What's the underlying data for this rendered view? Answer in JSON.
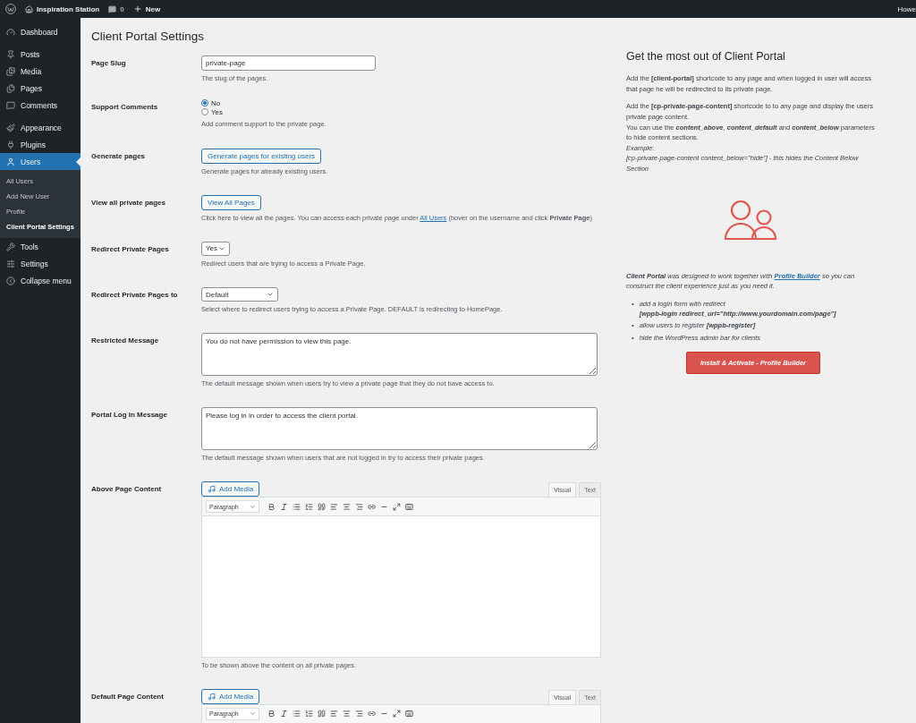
{
  "admin_bar": {
    "site_name": "Inspiration Station",
    "comments_count": "0",
    "new_label": "New",
    "greeting": "Howe"
  },
  "sidebar": {
    "items": [
      {
        "label": "Dashboard",
        "selected": false
      },
      {
        "label": "Posts",
        "selected": false
      },
      {
        "label": "Media",
        "selected": false
      },
      {
        "label": "Pages",
        "selected": false
      },
      {
        "label": "Comments",
        "selected": false
      },
      {
        "label": "Appearance",
        "selected": false
      },
      {
        "label": "Plugins",
        "selected": false
      },
      {
        "label": "Users",
        "selected": true,
        "children": [
          {
            "label": "All Users",
            "selected": false
          },
          {
            "label": "Add New User",
            "selected": false
          },
          {
            "label": "Profile",
            "selected": false
          },
          {
            "label": "Client Portal Settings",
            "selected": true
          }
        ]
      },
      {
        "label": "Tools",
        "selected": false
      },
      {
        "label": "Settings",
        "selected": false
      },
      {
        "label": "Collapse menu",
        "selected": false
      }
    ]
  },
  "page_title": "Client Portal Settings",
  "settings": [
    {
      "kind": "text",
      "label": "Page Slug",
      "value": "private-page",
      "description": "The slug of the pages."
    },
    {
      "kind": "radio",
      "label": "Support Comments",
      "options": [
        {
          "label": "No",
          "selected": true
        },
        {
          "label": "Yes",
          "selected": false
        }
      ],
      "description": "Add comment support to the private page."
    },
    {
      "kind": "button",
      "label": "Generate pages",
      "button": "Generate pages for existing users",
      "description": "Generate pages for already existing users."
    },
    {
      "kind": "button",
      "label": "View all private pages",
      "button": "View All Pages",
      "description": "Click here to view all the pages. You can access each private page under",
      "link": "All Users",
      "description_after": "(hover on the username and click **Private Page**)"
    },
    {
      "kind": "select",
      "label": "Redirect Private Pages",
      "value": "Yes",
      "description": "Redirect users that are trying to access a Private Page."
    },
    {
      "kind": "select",
      "label": "Redirect Private Pages to",
      "value": "Default",
      "description": "Select where to redirect users trying to access a Private Page. DEFAULT is redirecting to HomePage."
    },
    {
      "kind": "textarea",
      "label": "Restricted Message",
      "value": "You do not have permission to view this page.",
      "description": "The default message shown when users try to view a private page that they do not have access to."
    },
    {
      "kind": "textarea",
      "label": "Portal Log In Message",
      "value": "Please log in in order to access the client portal.",
      "description": "The default message shown when users that are not logged in try to access their private pages."
    },
    {
      "kind": "editor",
      "label": "Above Page Content",
      "add_media": "Add Media",
      "tabs": [
        {
          "label": "Visual",
          "selected": true
        },
        {
          "label": "Text",
          "selected": false
        }
      ],
      "format": "Paragraph",
      "description": "To be shown above the content on all private pages."
    },
    {
      "kind": "editor",
      "label": "Default Page Content",
      "add_media": "Add Media",
      "tabs": [
        {
          "label": "Visual",
          "selected": true
        },
        {
          "label": "Text",
          "selected": false
        }
      ],
      "format": "Paragraph"
    }
  ],
  "promo": {
    "heading": "Get the most out of Client Portal",
    "intro": "Add the **[client-portal]** shortcode to any page and when logged in user will access that page he will be redirected to its private page.",
    "lines": [
      {
        "text": "Add the **[cp-private-page-content]** shortcode to to any page and display the users private page content."
      },
      {
        "text": "You can use the **content_above**, **content_default** and **content_below** parameters to hide content sections."
      },
      {
        "text": "Example:"
      },
      {
        "text": "[cp-private-page-content content_below=\"hide\"] - this hides the Content Below Section"
      }
    ],
    "outro_before": "**Client Portal** was designed to work together with",
    "outro_link": "Profile Builder",
    "outro_after": "so you can construct the client experience just as you need it.",
    "bullets": [
      {
        "marker": "•",
        "text": "add a login form with redirect",
        "code": "[wppb-login redirect_url=\"http://www.yourdomain.com/page\"]"
      },
      {
        "marker": "•",
        "text": "allow users to register",
        "code": "[wppb-register]"
      },
      {
        "marker": "•",
        "text": "hide the WordPress admin bar for clients"
      }
    ],
    "button": "Install & Activate - Profile Builder"
  }
}
